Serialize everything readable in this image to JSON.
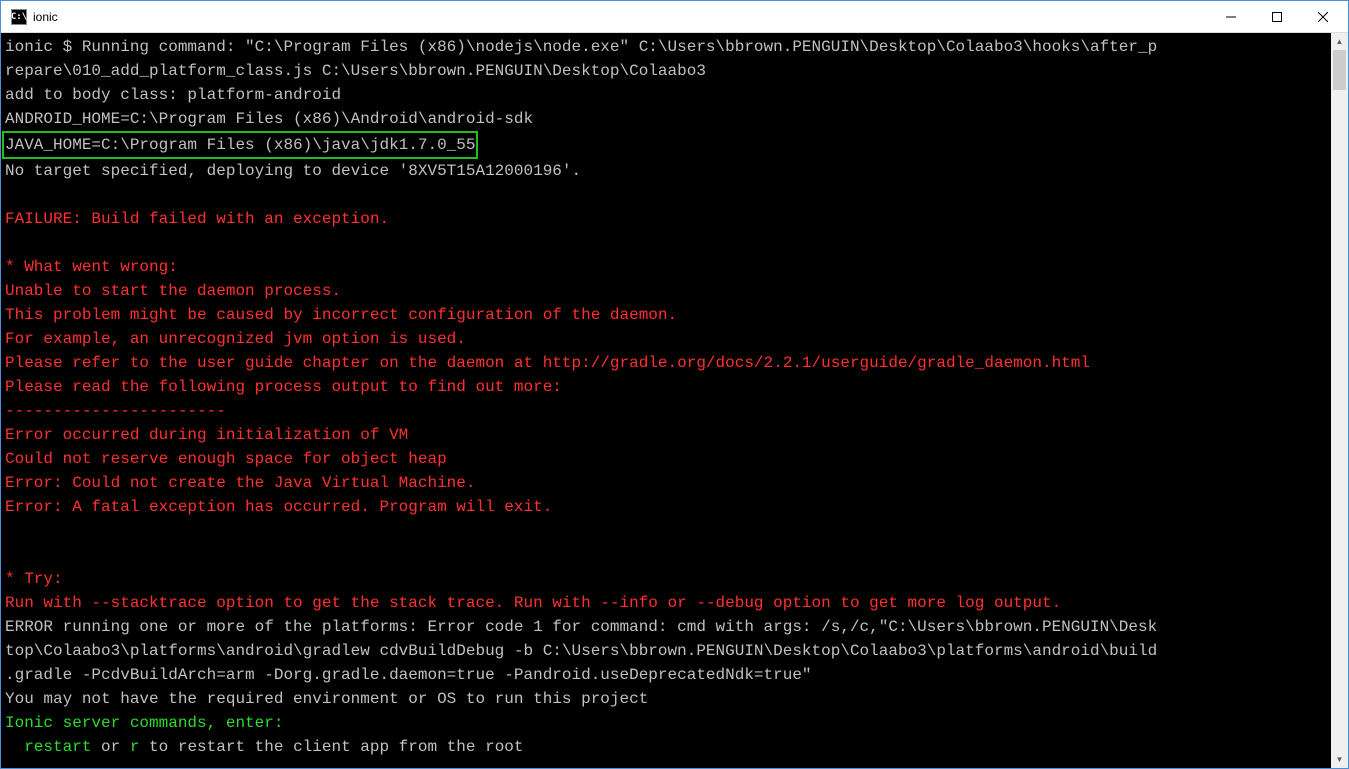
{
  "window": {
    "title": "ionic",
    "icon_text": "C:\\"
  },
  "terminal": {
    "lines": [
      {
        "cls": "gray",
        "text": "ionic $ Running command: \"C:\\Program Files (x86)\\nodejs\\node.exe\" C:\\Users\\bbrown.PENGUIN\\Desktop\\Colaabo3\\hooks\\after_p"
      },
      {
        "cls": "gray",
        "text": "repare\\010_add_platform_class.js C:\\Users\\bbrown.PENGUIN\\Desktop\\Colaabo3"
      },
      {
        "cls": "gray",
        "text": "add to body class: platform-android"
      },
      {
        "cls": "gray",
        "text": "ANDROID_HOME=C:\\Program Files (x86)\\Android\\android-sdk"
      },
      {
        "cls": "gray",
        "text": "JAVA_HOME=C:\\Program Files (x86)\\java\\jdk1.7.0_55",
        "highlighted": true
      },
      {
        "cls": "gray",
        "text": "No target specified, deploying to device '8XV5T15A12000196'."
      },
      {
        "cls": "gray",
        "text": ""
      },
      {
        "cls": "red",
        "text": "FAILURE: Build failed with an exception."
      },
      {
        "cls": "gray",
        "text": ""
      },
      {
        "cls": "red",
        "text": "* What went wrong:"
      },
      {
        "cls": "red",
        "text": "Unable to start the daemon process."
      },
      {
        "cls": "red",
        "text": "This problem might be caused by incorrect configuration of the daemon."
      },
      {
        "cls": "red",
        "text": "For example, an unrecognized jvm option is used."
      },
      {
        "cls": "red",
        "text": "Please refer to the user guide chapter on the daemon at http://gradle.org/docs/2.2.1/userguide/gradle_daemon.html"
      },
      {
        "cls": "red",
        "text": "Please read the following process output to find out more:"
      },
      {
        "cls": "red",
        "text": "-----------------------"
      },
      {
        "cls": "red",
        "text": "Error occurred during initialization of VM"
      },
      {
        "cls": "red",
        "text": "Could not reserve enough space for object heap"
      },
      {
        "cls": "red",
        "text": "Error: Could not create the Java Virtual Machine."
      },
      {
        "cls": "red",
        "text": "Error: A fatal exception has occurred. Program will exit."
      },
      {
        "cls": "gray",
        "text": ""
      },
      {
        "cls": "gray",
        "text": ""
      },
      {
        "cls": "red",
        "text": "* Try:"
      },
      {
        "cls": "red",
        "text": "Run with --stacktrace option to get the stack trace. Run with --info or --debug option to get more log output."
      },
      {
        "cls": "gray",
        "text": "ERROR running one or more of the platforms: Error code 1 for command: cmd with args: /s,/c,\"C:\\Users\\bbrown.PENGUIN\\Desk"
      },
      {
        "cls": "gray",
        "text": "top\\Colaabo3\\platforms\\android\\gradlew cdvBuildDebug -b C:\\Users\\bbrown.PENGUIN\\Desktop\\Colaabo3\\platforms\\android\\build"
      },
      {
        "cls": "gray",
        "text": ".gradle -PcdvBuildArch=arm -Dorg.gradle.daemon=true -Pandroid.useDeprecatedNdk=true\""
      },
      {
        "cls": "gray",
        "text": "You may not have the required environment or OS to run this project"
      },
      {
        "cls": "green",
        "text": "Ionic server commands, enter:"
      },
      {
        "cls": "green",
        "spans": [
          {
            "cls": "green",
            "text": "  restart"
          },
          {
            "cls": "gray",
            "text": " or "
          },
          {
            "cls": "green",
            "text": "r"
          },
          {
            "cls": "gray",
            "text": " to restart the client app from the root"
          }
        ]
      }
    ]
  }
}
